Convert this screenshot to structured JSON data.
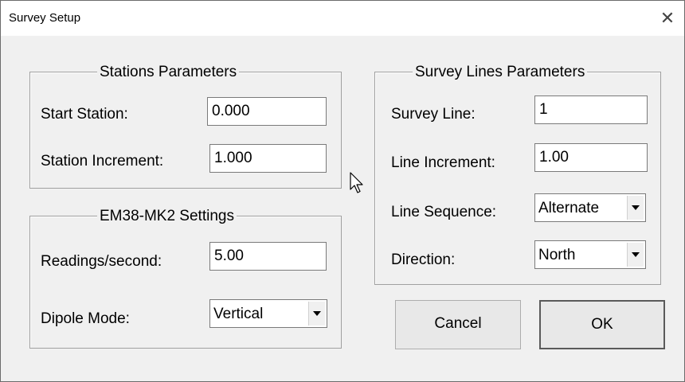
{
  "window": {
    "title": "Survey Setup",
    "close_glyph": "✕"
  },
  "stations": {
    "legend": "Stations Parameters",
    "start_label": "Start Station:",
    "start_value": "0.000",
    "increment_label": "Station Increment:",
    "increment_value": "1.000"
  },
  "em38": {
    "legend": "EM38-MK2 Settings",
    "readings_label": "Readings/second:",
    "readings_value": "5.00",
    "dipole_label": "Dipole Mode:",
    "dipole_value": "Vertical"
  },
  "lines": {
    "legend": "Survey Lines Parameters",
    "line_label": "Survey Line:",
    "line_value": "1",
    "increment_label": "Line Increment:",
    "increment_value": "1.00",
    "sequence_label": "Line Sequence:",
    "sequence_value": "Alternate",
    "direction_label": "Direction:",
    "direction_value": "North"
  },
  "buttons": {
    "cancel": "Cancel",
    "ok": "OK"
  },
  "icons": {
    "close": "close-icon",
    "dropdown": "chevron-down-icon",
    "cursor": "mouse-pointer-icon"
  }
}
